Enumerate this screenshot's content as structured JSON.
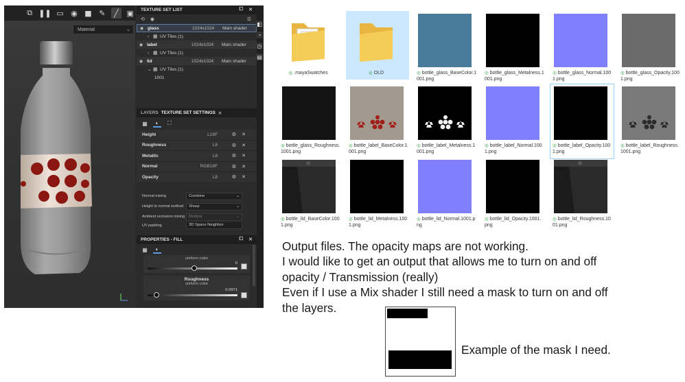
{
  "painter": {
    "viewport": {
      "toolbar_icons": [
        "screen-icon",
        "pause-icon",
        "layout-icon",
        "camera-icon",
        "video-icon",
        "brush-settings-icon",
        "paint-brush-icon",
        "screenshot-icon"
      ],
      "material_select": "Material"
    },
    "texture_set_list": {
      "title": "TEXTURE SET LIST",
      "rows": [
        {
          "name": "glass",
          "resolution": "1024x1024",
          "shader": "Main shader",
          "uv": "UV Tiles (1)"
        },
        {
          "name": "label",
          "resolution": "1024x1024",
          "shader": "Main shader",
          "uv": "UV Tiles (1)"
        },
        {
          "name": "lid",
          "resolution": "1024x1024",
          "shader": "Main shader",
          "uv": "UV Tiles (1)",
          "tile": "1001"
        }
      ]
    },
    "layers_panel": {
      "tab_layers": "LAYERS",
      "tab_settings": "TEXTURE SET SETTINGS",
      "channels": [
        {
          "name": "Height",
          "format": "L16F"
        },
        {
          "name": "Roughness",
          "format": "L8"
        },
        {
          "name": "Metallic",
          "format": "L8"
        },
        {
          "name": "Normal",
          "format": "RGB16F"
        },
        {
          "name": "Opacity",
          "format": "L8"
        }
      ],
      "settings": [
        {
          "label": "Normal mixing",
          "value": "Combine"
        },
        {
          "label": "Height to normal method",
          "value": "Sharp"
        },
        {
          "label": "Ambient occlusion mixing",
          "value": "Multiply"
        },
        {
          "label": "UV padding",
          "value": "3D Space Neighbor"
        }
      ]
    },
    "properties": {
      "title": "PROPERTIES - FILL",
      "first_sub": "uniform color",
      "first_value": "0",
      "first_level": 0.5,
      "second_title": "Roughness",
      "second_sub": "uniform color",
      "second_value": "0.0971",
      "second_level": 0.0971
    }
  },
  "files": [
    {
      "name": ".mayaSwatches",
      "kind": "folder"
    },
    {
      "name": "OLD",
      "kind": "folder",
      "selected": true
    },
    {
      "name": "bottle_glass_BaseColor.1001.png",
      "lines": [
        "bottle_glass_BaseColor.1",
        "001.png"
      ],
      "color": "#4a7a99"
    },
    {
      "name": "bottle_glass_Metalness.1001.png",
      "lines": [
        "bottle_glass_Metalness.1",
        "001.png"
      ],
      "color": "#000000"
    },
    {
      "name": "bottle_glass_Normal.1001.png",
      "lines": [
        "bottle_glass_Normal.100",
        "1.png"
      ],
      "color": "#8080ff"
    },
    {
      "name": "bottle_glass_Opacity.1001.png",
      "lines": [
        "bottle_glass_Opacity.100",
        "1.png"
      ],
      "color": "#6b6b6b"
    },
    {
      "name": "bottle_glass_Roughness.1001.png",
      "lines": [
        "bottle_glass_Roughness.",
        "1001.png"
      ],
      "color": "#141414"
    },
    {
      "name": "bottle_label_BaseColor.1001.png",
      "lines": [
        "bottle_label_BaseColor.1",
        "001.png"
      ],
      "color": "#a39a8f",
      "pattern": "red"
    },
    {
      "name": "bottle_label_Metalness.1001.png",
      "lines": [
        "bottle_label_Metalness.1",
        "001.png"
      ],
      "color": "#000000",
      "pattern": "white"
    },
    {
      "name": "bottle_label_Normal.1001.png",
      "lines": [
        "bottle_label_Normal.100",
        "1.png"
      ],
      "color": "#8080ff"
    },
    {
      "name": "bottle_label_Opacity.1001.png",
      "lines": [
        "bottle_label_Opacity.100",
        "1.png"
      ],
      "color": "#000000",
      "highlighted": true
    },
    {
      "name": "bottle_label_Roughness.1001.png",
      "lines": [
        "bottle_label_Roughness.",
        "1001.png"
      ],
      "color": "#7a7a7a",
      "pattern": "dark"
    },
    {
      "name": "bottle_lid_BaseColor.1001.png",
      "lines": [
        "bottle_lid_BaseColor.100",
        "1.png"
      ],
      "color": "#2a2a2a",
      "pattern": "lid"
    },
    {
      "name": "bottle_lid_Metalness.1001.png",
      "lines": [
        "bottle_lid_Metalness.100",
        "1.png"
      ],
      "color": "#000000"
    },
    {
      "name": "bottle_lid_Normal.1001.png",
      "lines": [
        "bottle_lid_Normal.1001.p",
        "ng"
      ],
      "color": "#8080ff"
    },
    {
      "name": "bottle_lid_Opacity.1001.png",
      "lines": [
        "bottle_lid_Opacity.1001.",
        "png"
      ],
      "color": "#000000"
    },
    {
      "name": "bottle_lid_Roughness.1001.png",
      "lines": [
        "bottle_lid_Roughness.10",
        "01.png"
      ],
      "color": "#2a2a2a",
      "pattern": "lid"
    }
  ],
  "notes": {
    "line1": "Output files.   The opacity maps are not working.",
    "line2": "I would like to get an output that allows me to turn on and off",
    "line3": "opacity / Transmission (really)",
    "line4": "Even if I use a Mix shader I still need a mask to turn on and off",
    "line5": "the layers.",
    "mask_caption": "Example of the mask I need."
  }
}
